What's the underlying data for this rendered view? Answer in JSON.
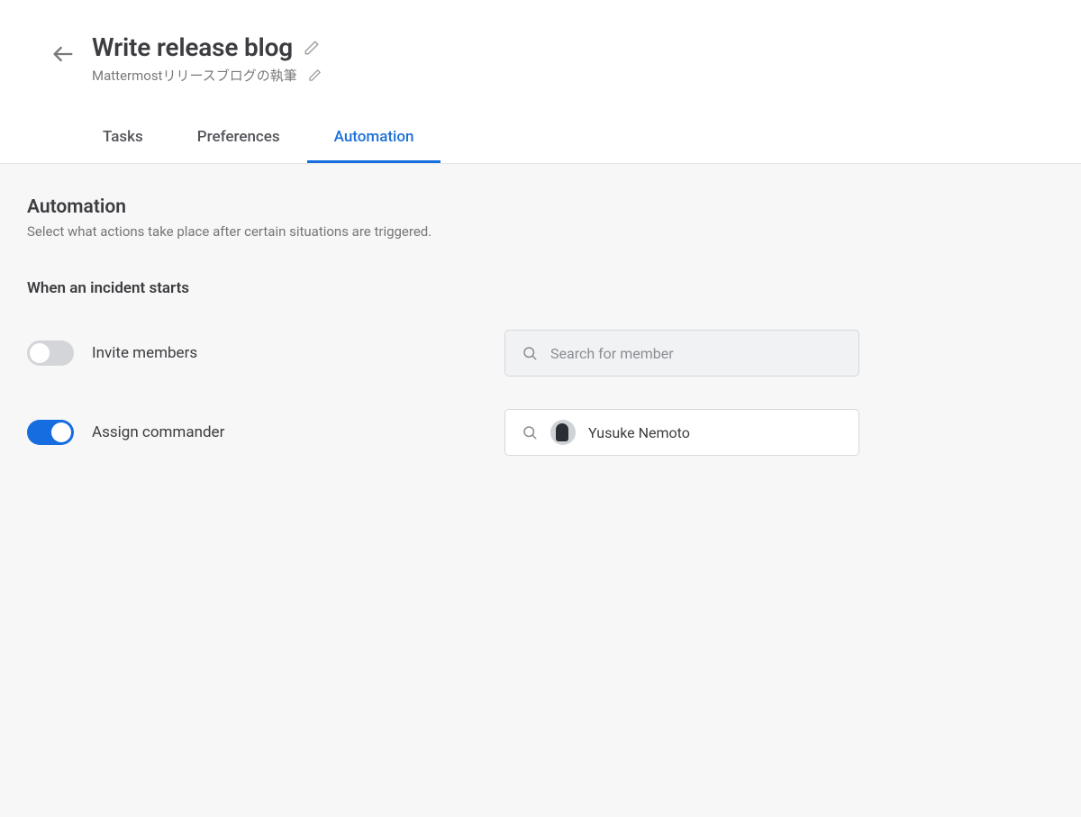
{
  "header": {
    "title": "Write release blog",
    "subtitle": "Mattermostリリースブログの執筆"
  },
  "tabs": {
    "tasks": "Tasks",
    "preferences": "Preferences",
    "automation": "Automation"
  },
  "panel": {
    "title": "Automation",
    "desc": "Select what actions take place after certain situations are triggered.",
    "section_heading": "When an incident starts"
  },
  "settings": {
    "invite_members": {
      "label": "Invite members",
      "enabled": false,
      "search_placeholder": "Search for member"
    },
    "assign_commander": {
      "label": "Assign commander",
      "enabled": true,
      "value": "Yusuke Nemoto"
    }
  },
  "colors": {
    "accent": "#166de0"
  }
}
